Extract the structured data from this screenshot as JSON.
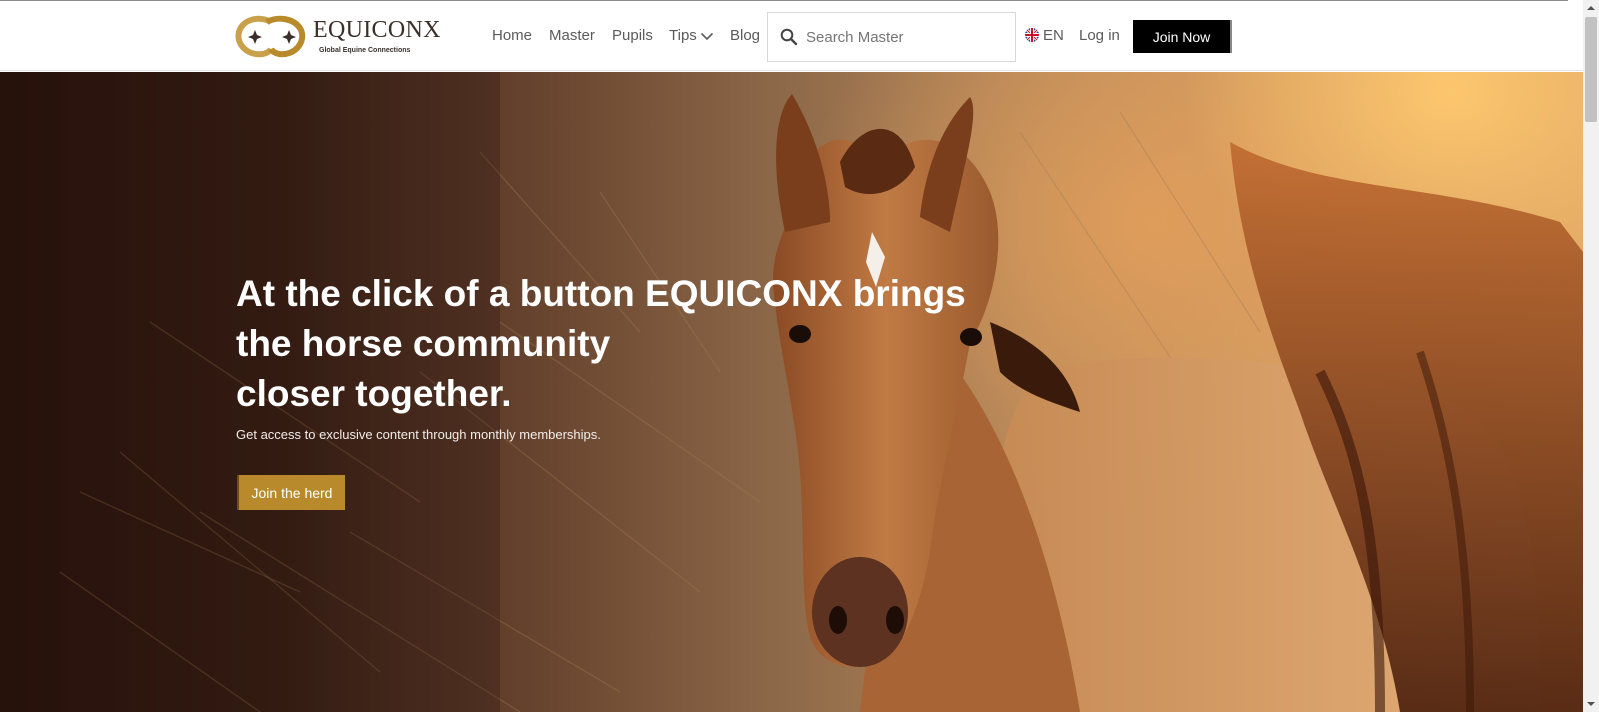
{
  "brand": {
    "name": "EQUICONX",
    "tagline": "Global Equine Connections",
    "colors": {
      "gold": "#b88a2b",
      "dark": "#3a2f2a"
    }
  },
  "nav": {
    "items": [
      {
        "label": "Home"
      },
      {
        "label": "Master"
      },
      {
        "label": "Pupils"
      },
      {
        "label": "Tips",
        "icon": "chevron-down-icon"
      },
      {
        "label": "Blog"
      }
    ]
  },
  "search": {
    "placeholder": "Search Master",
    "value": "",
    "icon": "search-icon"
  },
  "language": {
    "code": "EN",
    "icon": "uk-flag-icon"
  },
  "auth": {
    "login_label": "Log in",
    "join_label": "Join Now"
  },
  "hero": {
    "title_lines": [
      "At the click of a button EQUICONX brings",
      "the horse community",
      "closer together."
    ],
    "subtitle": "Get access to exclusive content through monthly memberships.",
    "cta_label": "Join the herd",
    "cta_color": "#b88a2b"
  }
}
